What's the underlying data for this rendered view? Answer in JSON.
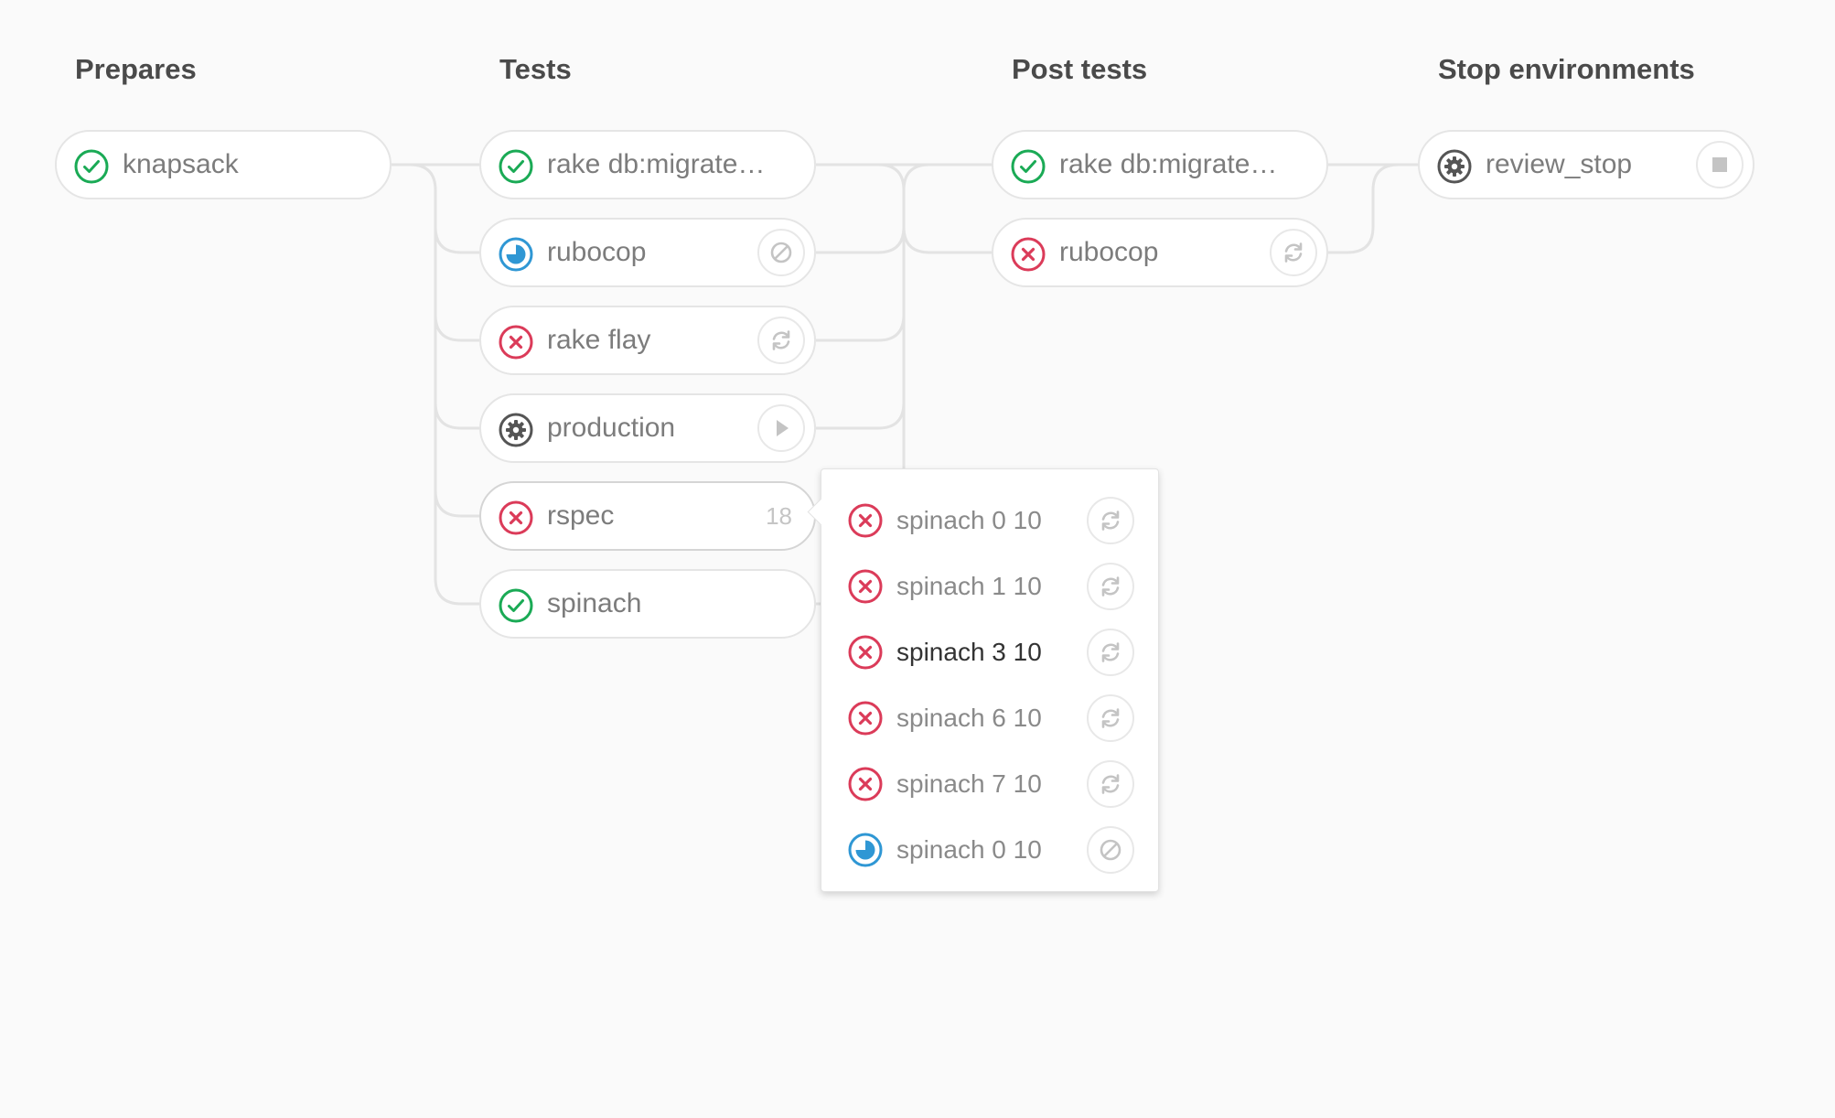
{
  "stages": [
    {
      "title": "Prepares",
      "jobs": [
        {
          "name": "knapsack",
          "status": "success",
          "status_icon": "check-circle-icon",
          "action": "none"
        }
      ]
    },
    {
      "title": "Tests",
      "jobs": [
        {
          "name": "rake db:migrate…",
          "status": "success",
          "status_icon": "check-circle-icon",
          "action": "none"
        },
        {
          "name": "rubocop",
          "status": "running",
          "status_icon": "running-icon",
          "action": "cancel",
          "action_icon": "cancel-icon"
        },
        {
          "name": "rake flay",
          "status": "failed",
          "status_icon": "failed-icon",
          "action": "retry",
          "action_icon": "retry-icon"
        },
        {
          "name": "production",
          "status": "manual",
          "status_icon": "gear-icon",
          "action": "play",
          "action_icon": "play-icon"
        },
        {
          "name": "rspec",
          "status": "failed",
          "status_icon": "failed-icon",
          "action": "group",
          "count": "18"
        },
        {
          "name": "spinach",
          "status": "success",
          "status_icon": "check-circle-icon",
          "action": "none"
        }
      ]
    },
    {
      "title": "Post tests",
      "jobs": [
        {
          "name": "rake db:migrate…",
          "status": "success",
          "status_icon": "check-circle-icon",
          "action": "none"
        },
        {
          "name": "rubocop",
          "status": "failed",
          "status_icon": "failed-icon",
          "action": "retry",
          "action_icon": "retry-icon"
        }
      ]
    },
    {
      "title": "Stop environments",
      "jobs": [
        {
          "name": "review_stop",
          "status": "manual",
          "status_icon": "gear-icon",
          "action": "stop",
          "action_icon": "stop-icon"
        }
      ]
    }
  ],
  "dropdown": {
    "items": [
      {
        "name": "spinach 0 10",
        "status": "failed",
        "status_icon": "failed-icon",
        "action": "retry",
        "action_icon": "retry-icon"
      },
      {
        "name": "spinach 1 10",
        "status": "failed",
        "status_icon": "failed-icon",
        "action": "retry",
        "action_icon": "retry-icon"
      },
      {
        "name": "spinach 3 10",
        "status": "failed",
        "status_icon": "failed-icon",
        "action": "retry",
        "action_icon": "retry-icon",
        "hovered": true
      },
      {
        "name": "spinach 6 10",
        "status": "failed",
        "status_icon": "failed-icon",
        "action": "retry",
        "action_icon": "retry-icon"
      },
      {
        "name": "spinach 7 10",
        "status": "failed",
        "status_icon": "failed-icon",
        "action": "retry",
        "action_icon": "retry-icon"
      },
      {
        "name": "spinach 0 10",
        "status": "running",
        "status_icon": "running-icon",
        "action": "cancel",
        "action_icon": "cancel-icon"
      }
    ]
  },
  "colors": {
    "success": "#1aaa55",
    "failed": "#db3b59",
    "running": "#2f97d4",
    "manual": "#555555",
    "connector": "#e3e3e3",
    "action_icon": "#c4c4c4"
  }
}
